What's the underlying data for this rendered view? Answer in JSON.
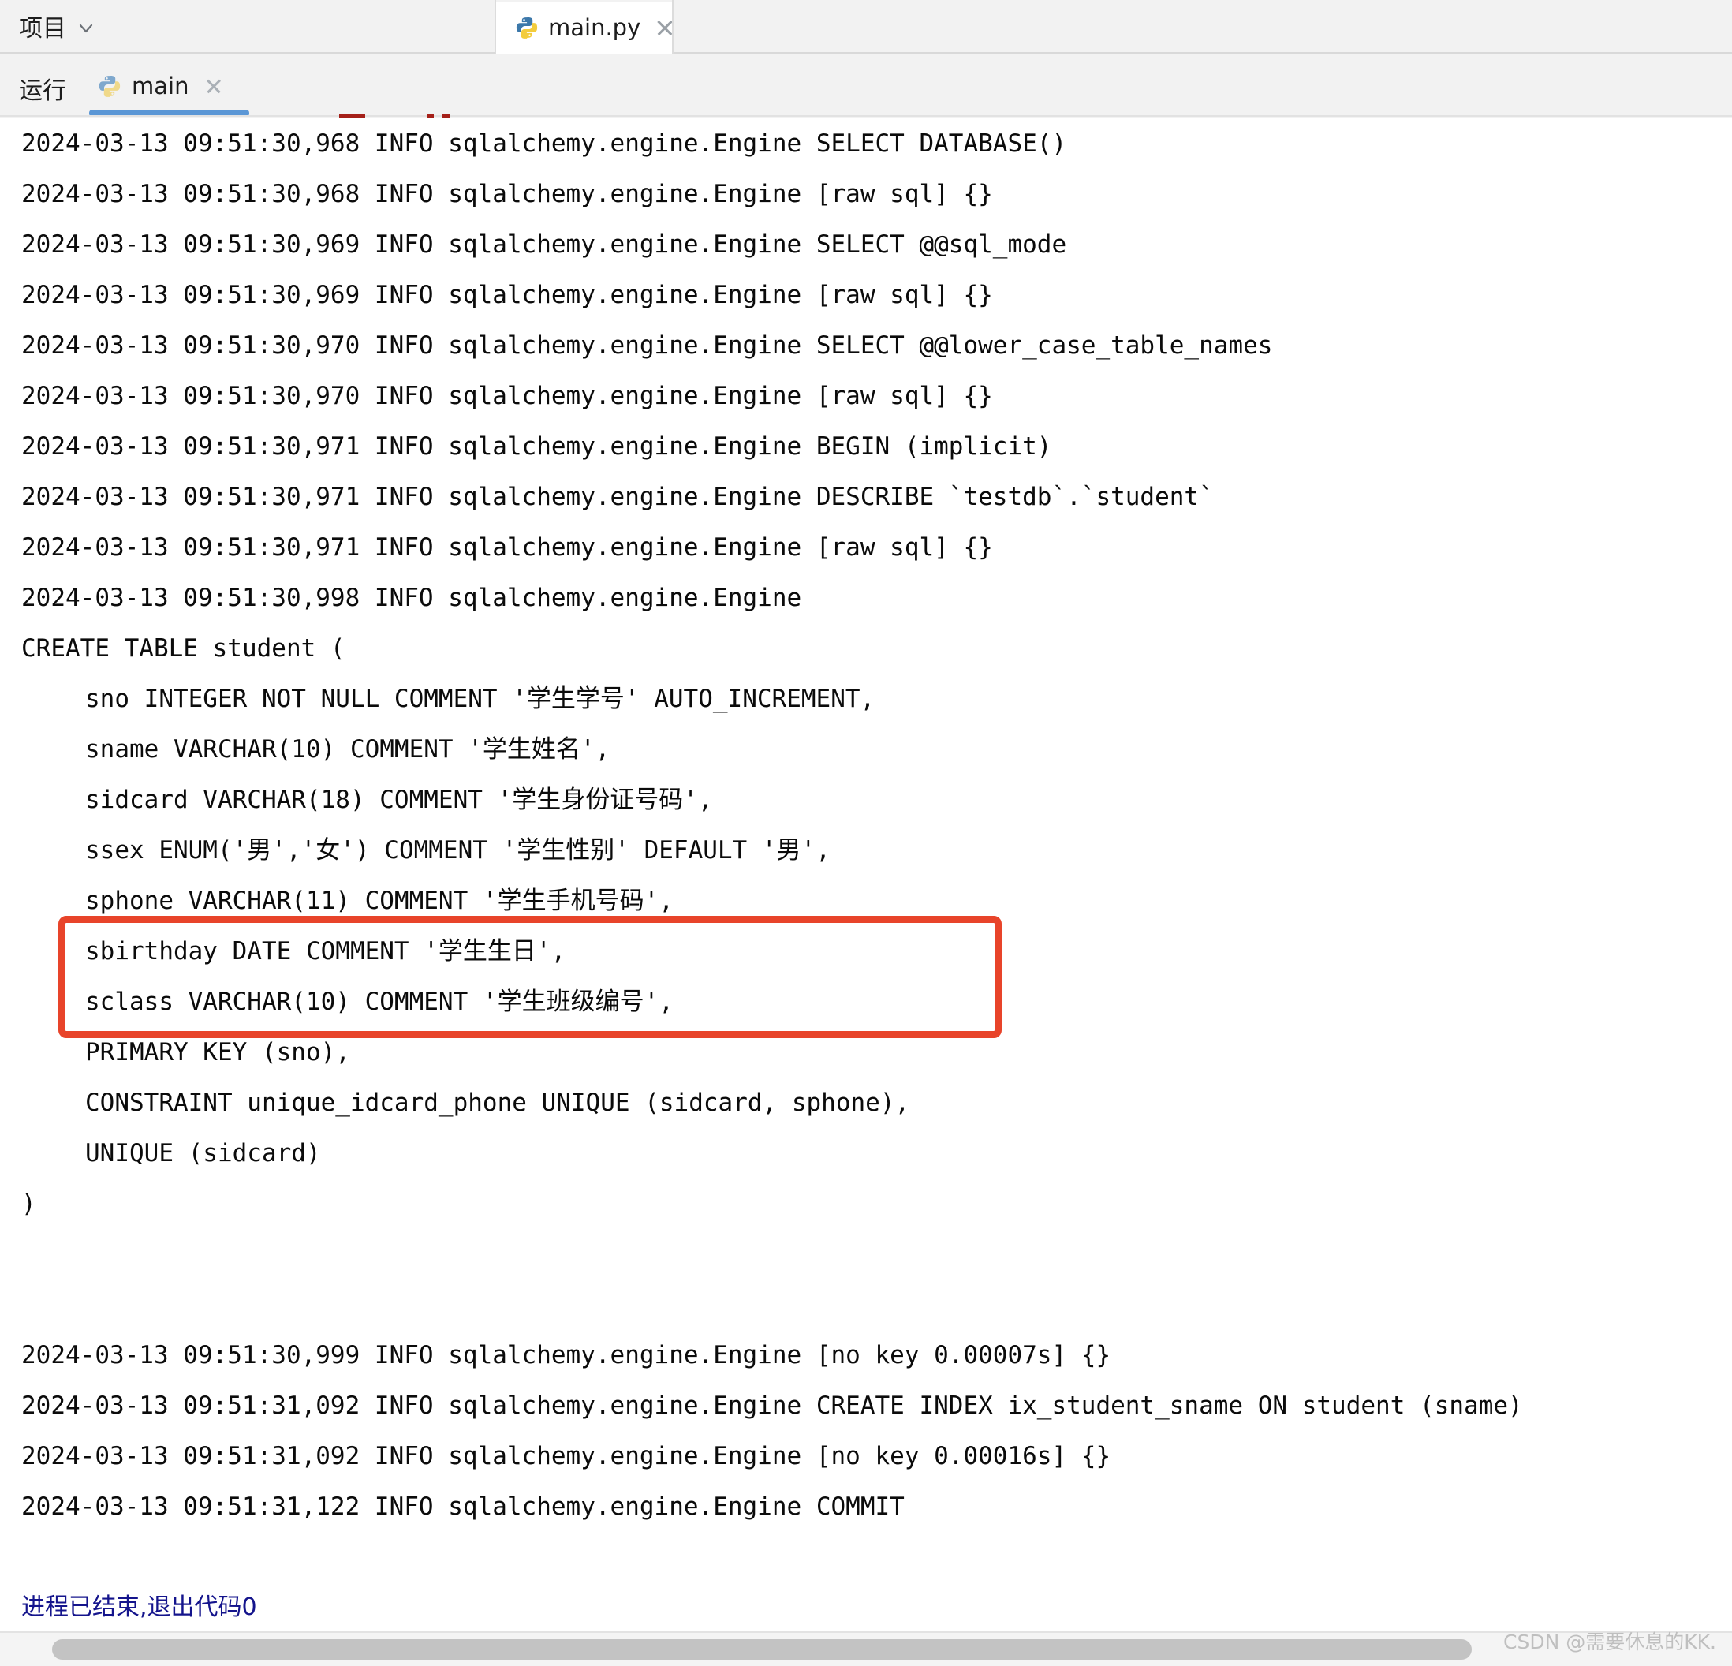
{
  "window": {
    "topbar": {
      "project_label": "项目",
      "project_chevron_icon": "chevron-down-icon",
      "editor_tab": {
        "filename": "main.py",
        "file_icon": "python-file-icon",
        "close_icon": "close-icon"
      }
    },
    "run_panel": {
      "title": "运行",
      "tab_label": "main",
      "tab_icon": "python-file-icon",
      "tab_close_icon": "close-icon",
      "active_tab_accent": "#5b97d6"
    }
  },
  "console": {
    "highlight_color": "#e8442a",
    "exit_text_color": "#14148c",
    "lines": [
      {
        "text": "2024-03-13 09:51:30,968 INFO sqlalchemy.engine.Engine SELECT DATABASE()",
        "indent": false
      },
      {
        "text": "2024-03-13 09:51:30,968 INFO sqlalchemy.engine.Engine [raw sql] {}",
        "indent": false
      },
      {
        "text": "2024-03-13 09:51:30,969 INFO sqlalchemy.engine.Engine SELECT @@sql_mode",
        "indent": false
      },
      {
        "text": "2024-03-13 09:51:30,969 INFO sqlalchemy.engine.Engine [raw sql] {}",
        "indent": false
      },
      {
        "text": "2024-03-13 09:51:30,970 INFO sqlalchemy.engine.Engine SELECT @@lower_case_table_names",
        "indent": false
      },
      {
        "text": "2024-03-13 09:51:30,970 INFO sqlalchemy.engine.Engine [raw sql] {}",
        "indent": false
      },
      {
        "text": "2024-03-13 09:51:30,971 INFO sqlalchemy.engine.Engine BEGIN (implicit)",
        "indent": false
      },
      {
        "text": "2024-03-13 09:51:30,971 INFO sqlalchemy.engine.Engine DESCRIBE `testdb`.`student`",
        "indent": false
      },
      {
        "text": "2024-03-13 09:51:30,971 INFO sqlalchemy.engine.Engine [raw sql] {}",
        "indent": false
      },
      {
        "text": "2024-03-13 09:51:30,998 INFO sqlalchemy.engine.Engine",
        "indent": false
      },
      {
        "text": "CREATE TABLE student (",
        "indent": false
      },
      {
        "text": "sno INTEGER NOT NULL COMMENT '学生学号' AUTO_INCREMENT,",
        "indent": true
      },
      {
        "text": "sname VARCHAR(10) COMMENT '学生姓名',",
        "indent": true
      },
      {
        "text": "sidcard VARCHAR(18) COMMENT '学生身份证号码',",
        "indent": true
      },
      {
        "text": "ssex ENUM('男','女') COMMENT '学生性别' DEFAULT '男',",
        "indent": true
      },
      {
        "text": "sphone VARCHAR(11) COMMENT '学生手机号码',",
        "indent": true
      },
      {
        "text": "sbirthday DATE COMMENT '学生生日',",
        "indent": true
      },
      {
        "text": "sclass VARCHAR(10) COMMENT '学生班级编号',",
        "indent": true
      },
      {
        "text": "PRIMARY KEY (sno),",
        "indent": true
      },
      {
        "text": "CONSTRAINT unique_idcard_phone UNIQUE (sidcard, sphone),",
        "indent": true
      },
      {
        "text": "UNIQUE (sidcard)",
        "indent": true
      },
      {
        "text": ")",
        "indent": false
      },
      {
        "text": "",
        "indent": false
      },
      {
        "text": "",
        "indent": false
      },
      {
        "text": "2024-03-13 09:51:30,999 INFO sqlalchemy.engine.Engine [no key 0.00007s] {}",
        "indent": false
      },
      {
        "text": "2024-03-13 09:51:31,092 INFO sqlalchemy.engine.Engine CREATE INDEX ix_student_sname ON student (sname)",
        "indent": false
      },
      {
        "text": "2024-03-13 09:51:31,092 INFO sqlalchemy.engine.Engine [no key 0.00016s] {}",
        "indent": false
      },
      {
        "text": "2024-03-13 09:51:31,122 INFO sqlalchemy.engine.Engine COMMIT",
        "indent": false
      },
      {
        "text": "",
        "indent": false
      },
      {
        "text": "进程已结束,退出代码0",
        "indent": false,
        "style": "exitmsg"
      }
    ]
  },
  "watermark": {
    "text": "CSDN @需要休息的KK."
  }
}
